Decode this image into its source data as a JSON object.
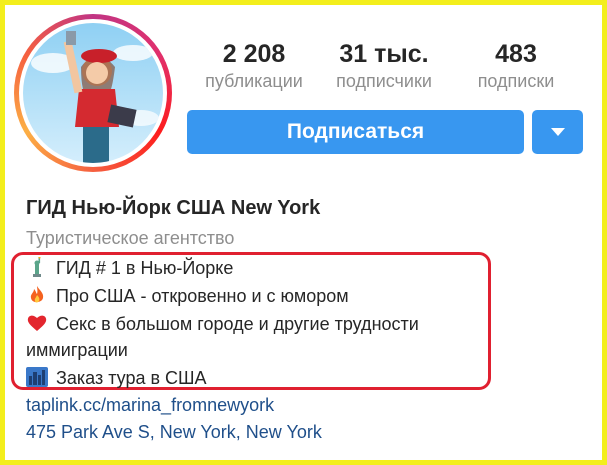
{
  "stats": [
    {
      "value": "2 208",
      "label": "публикации"
    },
    {
      "value": "31 тыс.",
      "label": "подписчики"
    },
    {
      "value": "483",
      "label": "подписки"
    }
  ],
  "follow_button": "Подписаться",
  "profile": {
    "name": "ГИД Нью-Йорк США New York",
    "category": "Туристическое агентство"
  },
  "bio": [
    {
      "icon": "statue-of-liberty-icon",
      "text": "ГИД # 1 в Нью-Йорке"
    },
    {
      "icon": "fire-icon",
      "text": "Про США - откровенно и с юмором"
    },
    {
      "icon": "heart-icon",
      "text": "Секс в большом городе и другие трудности"
    },
    {
      "icon": "",
      "text": "иммиграции"
    },
    {
      "icon": "cityscape-icon",
      "text": "Заказ тура в США"
    }
  ],
  "website": "taplink.cc/marina_fromnewyork",
  "address": "475 Park Ave S, New York, New York",
  "colors": {
    "accent": "#3897f0",
    "link": "#1f4f8a",
    "highlight": "#e02030",
    "frame": "#f3ee1c"
  }
}
